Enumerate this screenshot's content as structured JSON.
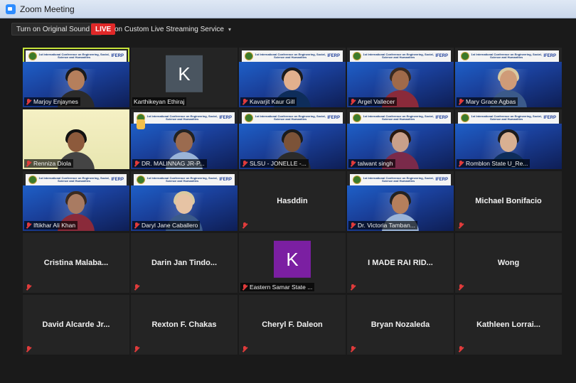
{
  "window": {
    "title": "Zoom Meeting"
  },
  "toolbar": {
    "audio_label": "Turn on Original Sound",
    "live_label": "LIVE",
    "stream_label": "on Custom Live Streaming Service",
    "caret": "▾"
  },
  "colors": {
    "active_speaker": "#c6e33a",
    "live": "#e02828",
    "muted_mic": "#e03b3b",
    "avatar_dark": "#4a5560",
    "avatar_purple": "#7b1fa2"
  },
  "banner": {
    "text": "1st International Conference on Engineering, Social, Science and Humanities",
    "logo": "IFERP"
  },
  "participants": [
    {
      "name": "Marjoy Enjaynes",
      "type": "video"
    },
    {
      "name": "Karthikeyan Ethiraj",
      "type": "avatar",
      "initial": "K"
    },
    {
      "name": "Kavarjit Kaur Gill",
      "type": "video"
    },
    {
      "name": "Argel Vallecer",
      "type": "video"
    },
    {
      "name": "Mary Grace Agbas",
      "type": "video"
    },
    {
      "name": "Renniza Diola",
      "type": "video"
    },
    {
      "name": "DR. MALINNAG JR-P...",
      "type": "video"
    },
    {
      "name": "SLSU - JONELLE -...",
      "type": "video"
    },
    {
      "name": "talwant singh",
      "type": "video"
    },
    {
      "name": "Romblon State U_Re...",
      "type": "video"
    },
    {
      "name": "Iftikhar Ali Khan",
      "type": "video"
    },
    {
      "name": "Daryl Jane Caballero",
      "type": "video"
    },
    {
      "name": "Hasddin",
      "type": "name"
    },
    {
      "name": "Dr. Victoria Tamban...",
      "type": "video"
    },
    {
      "name": "Michael Bonifacio",
      "type": "name"
    },
    {
      "name": "Cristina  Malaba...",
      "type": "name"
    },
    {
      "name": "Darin Jan Tindo...",
      "type": "name"
    },
    {
      "name": "Eastern Samar State ...",
      "type": "avatar",
      "initial": "K"
    },
    {
      "name": "I MADE RAI RID...",
      "type": "name"
    },
    {
      "name": "Wong",
      "type": "name"
    },
    {
      "name": "David Alcarde Jr...",
      "type": "name"
    },
    {
      "name": "Rexton F. Chakas",
      "type": "name"
    },
    {
      "name": "Cheryl F. Daleon",
      "type": "name"
    },
    {
      "name": "Bryan Nozaleda",
      "type": "name"
    },
    {
      "name": "Kathleen  Lorrai...",
      "type": "name"
    }
  ]
}
